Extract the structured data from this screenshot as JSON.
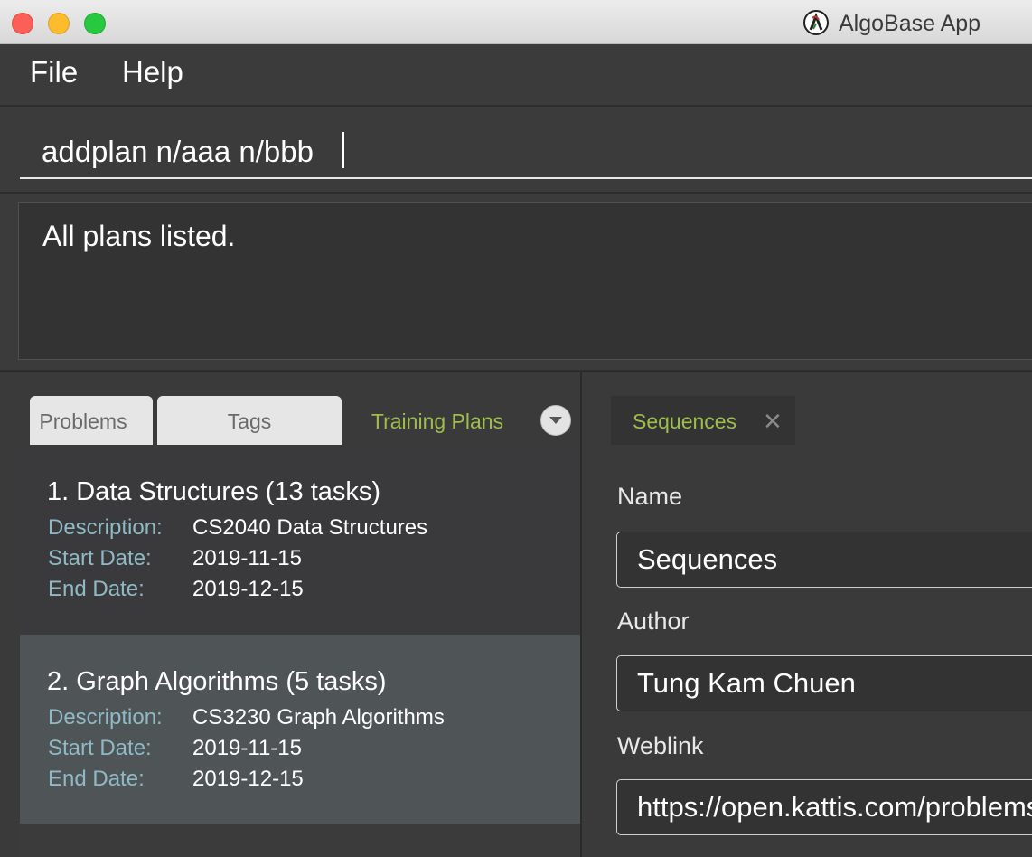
{
  "window": {
    "title": "AlgoBase App"
  },
  "menu": {
    "file": "File",
    "help": "Help"
  },
  "command": {
    "value": "addplan n/aaa n/bbb"
  },
  "result": {
    "text": "All plans listed."
  },
  "tabs": {
    "problems": "Problems",
    "tags": "Tags",
    "training_plans": "Training Plans"
  },
  "plans": [
    {
      "title": "1.  Data Structures (13 tasks)",
      "description_label": "Description:",
      "description": "CS2040 Data Structures",
      "start_label": "Start Date:",
      "start": "2019-11-15",
      "end_label": "End Date:",
      "end": "2019-12-15"
    },
    {
      "title": "2.  Graph Algorithms (5 tasks)",
      "description_label": "Description:",
      "description": "CS3230 Graph Algorithms",
      "start_label": "Start Date:",
      "start": "2019-11-15",
      "end_label": "End Date:",
      "end": "2019-12-15"
    }
  ],
  "detail": {
    "tab": "Sequences",
    "name_label": "Name",
    "name": "Sequences",
    "author_label": "Author",
    "author": "Tung Kam Chuen",
    "weblink_label": "Weblink",
    "weblink": "https://open.kattis.com/problems/sequences"
  },
  "colors": {
    "accent_green": "#9ebd4a",
    "label_blue": "#8fb9c4",
    "background": "#3a3a3b",
    "selected_row": "#4f5457"
  }
}
